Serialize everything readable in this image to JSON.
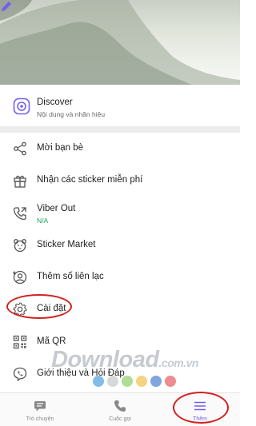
{
  "discover": {
    "title": "Discover",
    "subtitle": "Nội dung và nhãn hiệu"
  },
  "menu": {
    "items": [
      {
        "label": "Mời bạn bè",
        "icon": "share-icon"
      },
      {
        "label": "Nhận các sticker miễn phí",
        "icon": "gift-icon"
      },
      {
        "label": "Viber Out",
        "sub": "N/A",
        "icon": "viber-out-icon"
      },
      {
        "label": "Sticker Market",
        "icon": "sticker-bear-icon"
      },
      {
        "label": "Thêm số liên lạc",
        "icon": "add-contact-icon"
      },
      {
        "label": "Cài đặt",
        "icon": "gear-icon"
      },
      {
        "label": "Mã QR",
        "icon": "qr-code-icon"
      },
      {
        "label": "Giới thiệu và Hỏi Đáp",
        "icon": "viber-info-icon"
      }
    ]
  },
  "tabs": [
    {
      "label": "Trò chuyện",
      "icon": "chat-icon",
      "active": false
    },
    {
      "label": "Cuộc gọi",
      "icon": "phone-icon",
      "active": false
    },
    {
      "label": "Thêm",
      "icon": "hamburger-menu-icon",
      "active": true
    }
  ],
  "watermark": {
    "text": "Download",
    "suffix": ".com.vn"
  },
  "colors": {
    "accent": "#7360f2",
    "annotation": "#d32020",
    "viber_out_sub": "#1fa355"
  }
}
